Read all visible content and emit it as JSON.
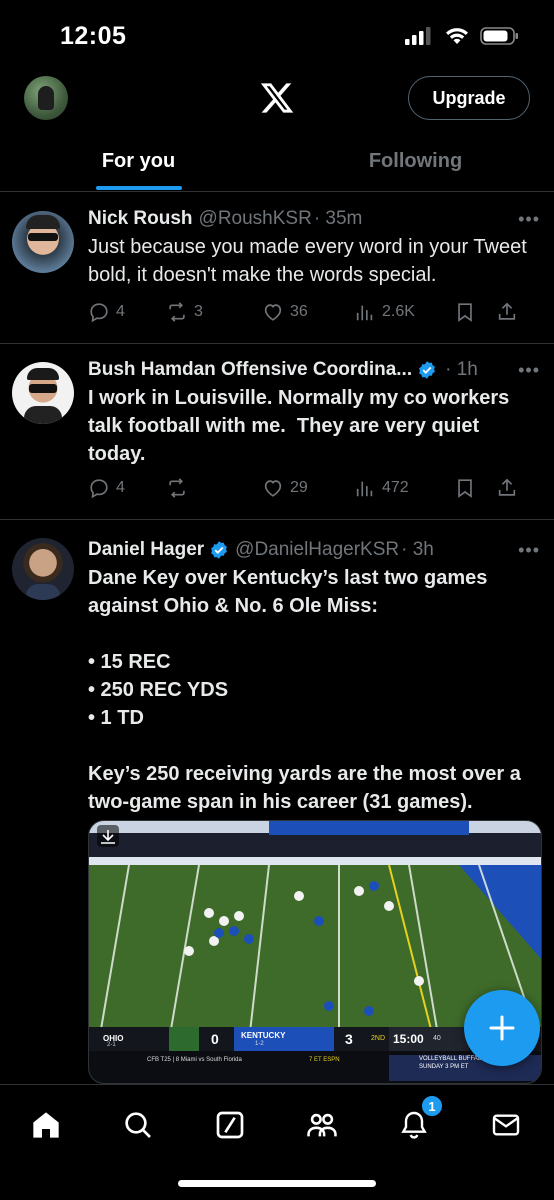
{
  "status": {
    "time": "12:05"
  },
  "header": {
    "upgrade_label": "Upgrade"
  },
  "tabs": [
    {
      "label": "For you",
      "active": true
    },
    {
      "label": "Following",
      "active": false
    }
  ],
  "tweets": [
    {
      "name": "Nick Roush",
      "handle": "@RoushKSR",
      "time": "· 35m",
      "verified": false,
      "text": "Just because you made every word in your Tweet bold, it doesn't make the words special.",
      "replies": "4",
      "reposts": "3",
      "likes": "36",
      "views": "2.6K"
    },
    {
      "name": "Bush Hamdan Offensive Coordina...",
      "handle": "",
      "time": "· 1h",
      "verified": true,
      "text": "I work in Louisville. Normally my co workers talk football with me.  They are very quiet today.",
      "replies": "4",
      "reposts": "",
      "likes": "29",
      "views": "472"
    },
    {
      "name": "Daniel Hager",
      "handle": "@DanielHagerKSR",
      "time": "· 3h",
      "verified": true,
      "text": "Dane Key over Kentucky’s last two games against Ohio & No. 6 Ole Miss:\n\n• 15 REC\n• 250 REC YDS\n• 1 TD\n\nKey’s 250 receiving yards are the most over a two-game span in his career (31 games)."
    }
  ],
  "media": {
    "scorebug_team1": "OHIO",
    "scorebug_team1_record": "2-1",
    "scorebug_score1": "0",
    "scorebug_team2": "KENTUCKY",
    "scorebug_team2_record": "1-2",
    "scorebug_score2": "3",
    "scorebug_quarter": "2ND",
    "scorebug_clock": "15:00",
    "scorebug_playclock": "40",
    "ticker_left": "CFB T25 | 8 Miami vs South Florida",
    "ticker_mid": "7 ET ESPN",
    "ticker_right": "VOLLEYBALL BUFFALO AT FLORIDA SUNDAY 3 PM ET"
  },
  "nav": {
    "notification_count": "1"
  },
  "colors": {
    "accent": "#1d9bf0",
    "muted": "#71767b",
    "background": "#000000",
    "divider": "#2f3336"
  }
}
